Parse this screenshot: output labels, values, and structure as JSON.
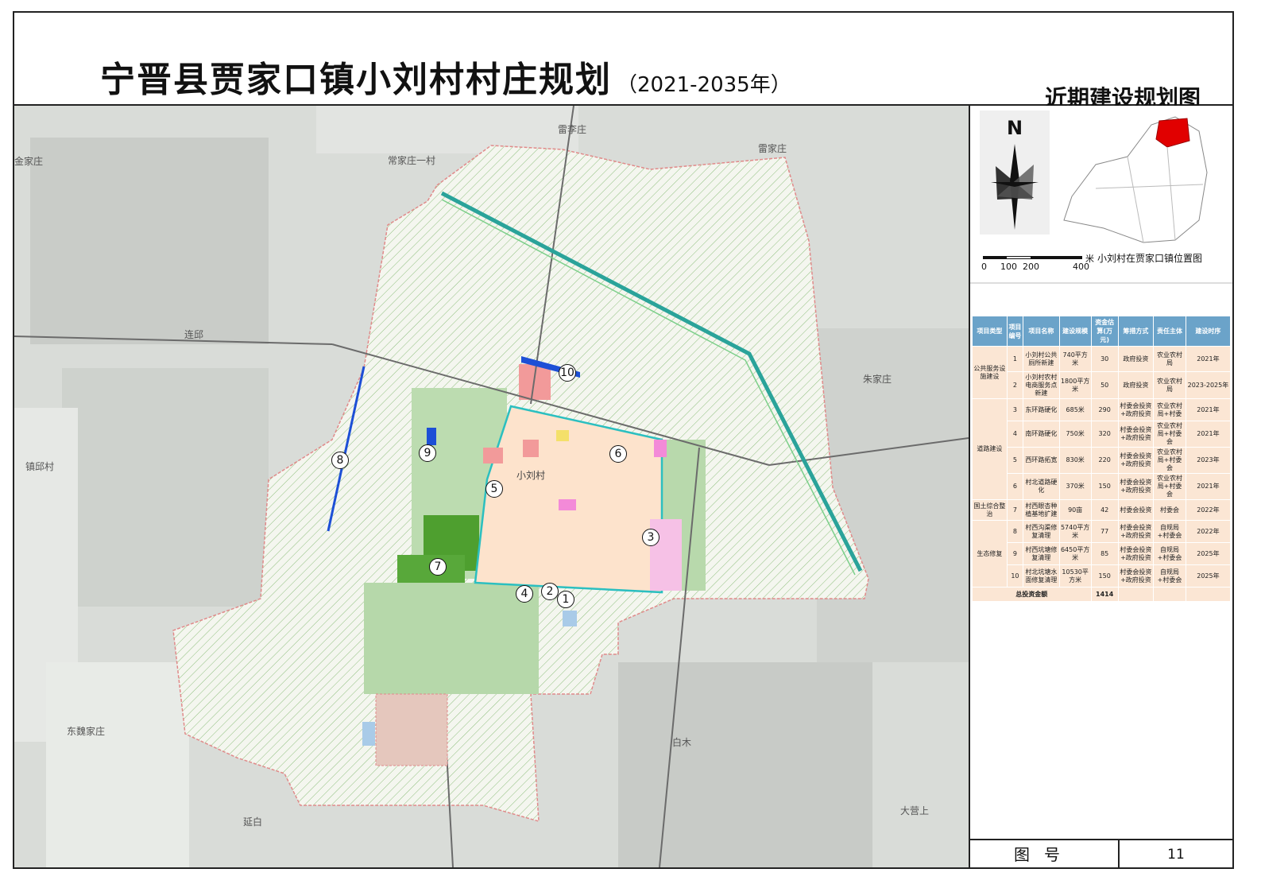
{
  "title": {
    "main": "宁晋县贾家口镇小刘村村庄规划",
    "years": "（2021-2035年）",
    "sub": "近期建设规划图"
  },
  "map": {
    "village_center_label": "小刘村",
    "place_names": [
      "金家庄",
      "常家庄一村",
      "雷李庄",
      "雷家庄",
      "连邱",
      "朱家庄",
      "镇邱村",
      "东魏家庄",
      "白木",
      "延白",
      "大营上"
    ],
    "markers": [
      "1",
      "2",
      "3",
      "4",
      "5",
      "6",
      "7",
      "8",
      "9",
      "10"
    ]
  },
  "sidebar": {
    "compass": "N",
    "scale_unit": "米",
    "scale_ticks": [
      "0",
      "100",
      "200",
      "400"
    ],
    "location_map_caption": "小刘村在贾家口镇位置图"
  },
  "table": {
    "headers": [
      "项目类型",
      "项目编号",
      "项目名称",
      "建设规模",
      "资金估算(万元)",
      "筹措方式",
      "责任主体",
      "建设时序"
    ],
    "rows": [
      {
        "cat": "公共服务设施建设",
        "no": "1",
        "name": "小刘村公共厕所新建",
        "scale": "740平方米",
        "fund": "30",
        "way": "政府投资",
        "owner": "农业农村局",
        "time": "2021年"
      },
      {
        "cat": "",
        "no": "2",
        "name": "小刘村农村电商服务点新建",
        "scale": "1800平方米",
        "fund": "50",
        "way": "政府投资",
        "owner": "农业农村局",
        "time": "2023-2025年"
      },
      {
        "cat": "道路建设",
        "no": "3",
        "name": "东环路硬化",
        "scale": "685米",
        "fund": "290",
        "way": "村委会投资+政府投资",
        "owner": "农业农村局+村委",
        "time": "2021年"
      },
      {
        "cat": "",
        "no": "4",
        "name": "南环路硬化",
        "scale": "750米",
        "fund": "320",
        "way": "村委会投资+政府投资",
        "owner": "农业农村局+村委会",
        "time": "2021年"
      },
      {
        "cat": "",
        "no": "5",
        "name": "西环路拓宽",
        "scale": "830米",
        "fund": "220",
        "way": "村委会投资+政府投资",
        "owner": "农业农村局+村委会",
        "time": "2023年"
      },
      {
        "cat": "",
        "no": "6",
        "name": "村北道路硬化",
        "scale": "370米",
        "fund": "150",
        "way": "村委会投资+政府投资",
        "owner": "农业农村局+村委会",
        "time": "2021年"
      },
      {
        "cat": "国土综合整治",
        "no": "7",
        "name": "村西眼杏种植基地扩建",
        "scale": "90亩",
        "fund": "42",
        "way": "村委会投资",
        "owner": "村委会",
        "time": "2022年"
      },
      {
        "cat": "生态修复",
        "no": "8",
        "name": "村西沟渠修复清理",
        "scale": "5740平方米",
        "fund": "77",
        "way": "村委会投资+政府投资",
        "owner": "自规局+村委会",
        "time": "2022年"
      },
      {
        "cat": "",
        "no": "9",
        "name": "村西坑塘修复清理",
        "scale": "6450平方米",
        "fund": "85",
        "way": "村委会投资+政府投资",
        "owner": "自规局+村委会",
        "time": "2025年"
      },
      {
        "cat": "",
        "no": "10",
        "name": "村北坑塘水面修复清理",
        "scale": "10530平方米",
        "fund": "150",
        "way": "村委会投资+政府投资",
        "owner": "自规局+村委会",
        "time": "2025年"
      }
    ],
    "total_label": "总投资金额",
    "total_value": "1414"
  },
  "figure": {
    "label": "图号",
    "number": "11"
  },
  "colors": {
    "header_blue": "#6ba3c9",
    "table_peach": "#fbe6d4",
    "road_cyan": "#2bbfc0",
    "canal_blue": "#1d4fd6",
    "village_fill": "#fde3cc",
    "farmland_green": "#58a83a"
  }
}
